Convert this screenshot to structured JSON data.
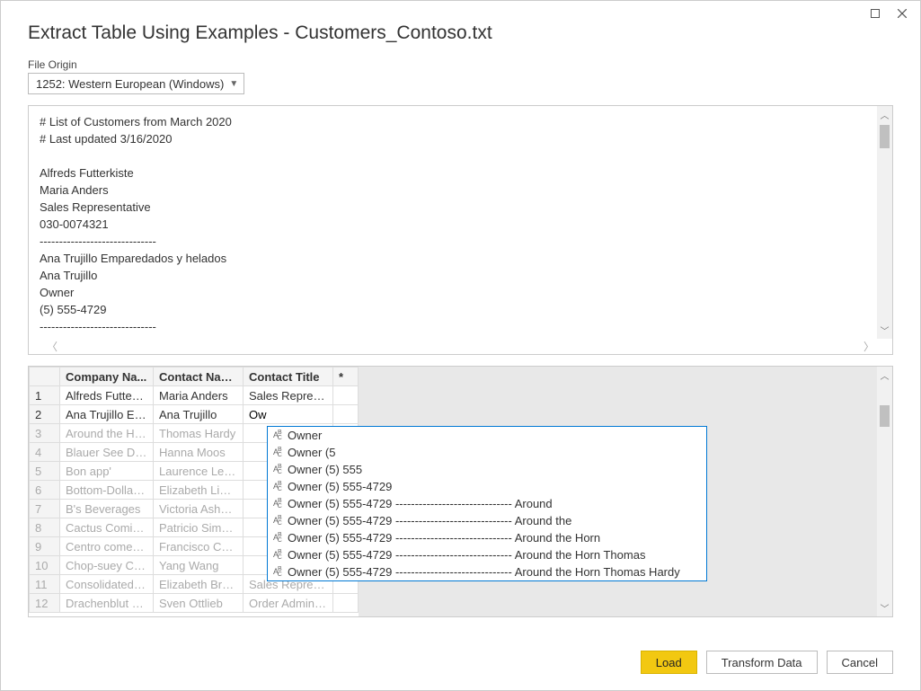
{
  "window": {
    "title": "Extract Table Using Examples - Customers_Contoso.txt"
  },
  "fileOrigin": {
    "label": "File Origin",
    "selected": "1252: Western European (Windows)"
  },
  "preview": {
    "lines": [
      "# List of Customers from March 2020",
      "# Last updated 3/16/2020",
      "",
      "Alfreds Futterkiste",
      "Maria Anders",
      "Sales Representative",
      "030-0074321",
      "------------------------------",
      "Ana Trujillo Emparedados y helados",
      "Ana Trujillo",
      "Owner",
      "(5) 555-4729",
      "------------------------------"
    ]
  },
  "grid": {
    "headers": {
      "company": "Company Na...",
      "contact": "Contact Name",
      "title": "Contact Title",
      "star": "*"
    },
    "rows": [
      {
        "n": "1",
        "company": "Alfreds Futterki...",
        "contact": "Maria Anders",
        "title": "Sales Represen...",
        "ghost": false,
        "editing": false
      },
      {
        "n": "2",
        "company": "Ana Trujillo Em...",
        "contact": "Ana Trujillo",
        "title": "Ow",
        "ghost": false,
        "editing": true
      },
      {
        "n": "3",
        "company": "Around the Horn",
        "contact": "Thomas Hardy",
        "title": "",
        "ghost": true,
        "editing": false
      },
      {
        "n": "4",
        "company": "Blauer See Deli...",
        "contact": "Hanna Moos",
        "title": "",
        "ghost": true,
        "editing": false
      },
      {
        "n": "5",
        "company": "Bon app'",
        "contact": "Laurence Lebih...",
        "title": "",
        "ghost": true,
        "editing": false
      },
      {
        "n": "6",
        "company": "Bottom-Dollar ...",
        "contact": "Elizabeth Lincoln",
        "title": "",
        "ghost": true,
        "editing": false
      },
      {
        "n": "7",
        "company": "B's Beverages",
        "contact": "Victoria Ashwo...",
        "title": "",
        "ghost": true,
        "editing": false
      },
      {
        "n": "8",
        "company": "Cactus Comida...",
        "contact": "Patricio Simpson",
        "title": "",
        "ghost": true,
        "editing": false
      },
      {
        "n": "9",
        "company": "Centro comerci...",
        "contact": "Francisco Chang",
        "title": "",
        "ghost": true,
        "editing": false
      },
      {
        "n": "10",
        "company": "Chop-suey Chi...",
        "contact": "Yang Wang",
        "title": "",
        "ghost": true,
        "editing": false
      },
      {
        "n": "11",
        "company": "Consolidated H...",
        "contact": "Elizabeth Brown",
        "title": "Sales Represen...",
        "ghost": true,
        "editing": false
      },
      {
        "n": "12",
        "company": "Drachenblut D...",
        "contact": "Sven Ottlieb",
        "title": "Order Administ...",
        "ghost": true,
        "editing": false
      }
    ]
  },
  "suggestions": [
    "Owner",
    "Owner (5",
    "Owner (5) 555",
    "Owner (5) 555-4729",
    "Owner (5) 555-4729 ------------------------------ Around",
    "Owner (5) 555-4729 ------------------------------ Around the",
    "Owner (5) 555-4729 ------------------------------ Around the Horn",
    "Owner (5) 555-4729 ------------------------------ Around the Horn Thomas",
    "Owner (5) 555-4729 ------------------------------ Around the Horn Thomas Hardy"
  ],
  "buttons": {
    "load": "Load",
    "transform": "Transform Data",
    "cancel": "Cancel"
  }
}
